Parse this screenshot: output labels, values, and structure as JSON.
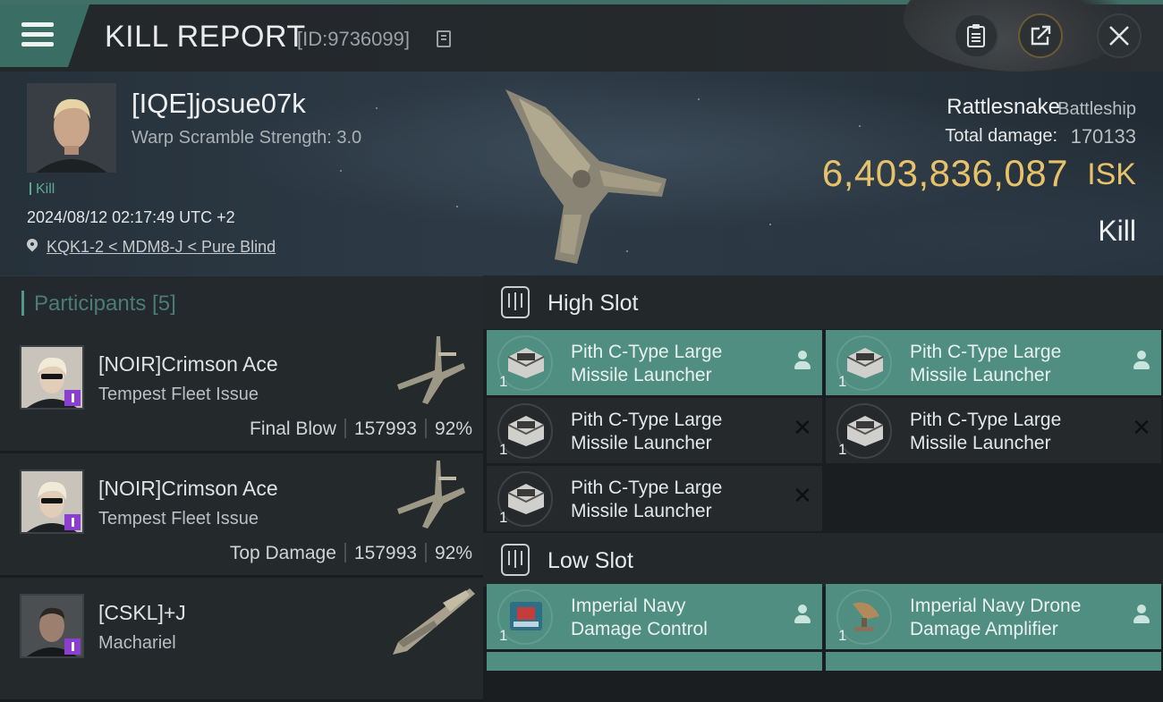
{
  "header": {
    "title": "KILL REPORT",
    "report_id": "[ID:9736099]"
  },
  "icons": {
    "menu": "hamburger-menu-icon",
    "copy": "copy-icon",
    "clipboard": "clipboard-icon",
    "share": "share-export-icon",
    "close": "close-icon",
    "location": "location-pin-icon",
    "slot": "slot-rack-icon",
    "owner": "person-icon",
    "destroyed": "x-icon"
  },
  "colors": {
    "accent": "#4f8e80",
    "isk": "#e7c26a",
    "rare_badge": "#8a3fd0"
  },
  "victim": {
    "name": "[IQE]josue07k",
    "warp_scramble": "Warp Scramble Strength: 3.0",
    "kill_tag": "Kill",
    "datetime": "2024/08/12 02:17:49 UTC +2",
    "location": "KQK1-2 < MDM8-J < Pure Blind",
    "ship_name": "Rattlesnake",
    "ship_class": "Battleship",
    "total_damage_label": "Total damage:",
    "total_damage": "170133",
    "isk_value": "6,403,836,087",
    "isk_unit": "ISK",
    "outcome": "Kill"
  },
  "participants": {
    "title": "Participants [5]",
    "rows": [
      {
        "name": "[NOIR]Crimson Ace",
        "ship": "Tempest Fleet Issue",
        "role": "Final Blow",
        "damage": "157993",
        "percent": "92%"
      },
      {
        "name": "[NOIR]Crimson Ace",
        "ship": "Tempest Fleet Issue",
        "role": "Top Damage",
        "damage": "157993",
        "percent": "92%"
      },
      {
        "name": "[CSKL]+J",
        "ship": "Machariel",
        "role": "",
        "damage": "",
        "percent": ""
      }
    ]
  },
  "fitting": {
    "high_slot": {
      "title": "High Slot",
      "modules": [
        {
          "line1": "Pith C-Type Large",
          "line2": "Missile Launcher",
          "qty": "1",
          "state": "dropped"
        },
        {
          "line1": "Pith C-Type Large",
          "line2": "Missile Launcher",
          "qty": "1",
          "state": "dropped"
        },
        {
          "line1": "Pith C-Type Large",
          "line2": "Missile Launcher",
          "qty": "1",
          "state": "destroyed"
        },
        {
          "line1": "Pith C-Type Large",
          "line2": "Missile Launcher",
          "qty": "1",
          "state": "destroyed"
        },
        {
          "line1": "Pith C-Type Large",
          "line2": "Missile Launcher",
          "qty": "1",
          "state": "destroyed"
        }
      ]
    },
    "low_slot": {
      "title": "Low Slot",
      "modules": [
        {
          "line1": "Imperial Navy",
          "line2": "Damage Control",
          "qty": "1",
          "state": "dropped"
        },
        {
          "line1": "Imperial Navy Drone",
          "line2": "Damage Amplifier",
          "qty": "1",
          "state": "dropped"
        }
      ]
    }
  }
}
